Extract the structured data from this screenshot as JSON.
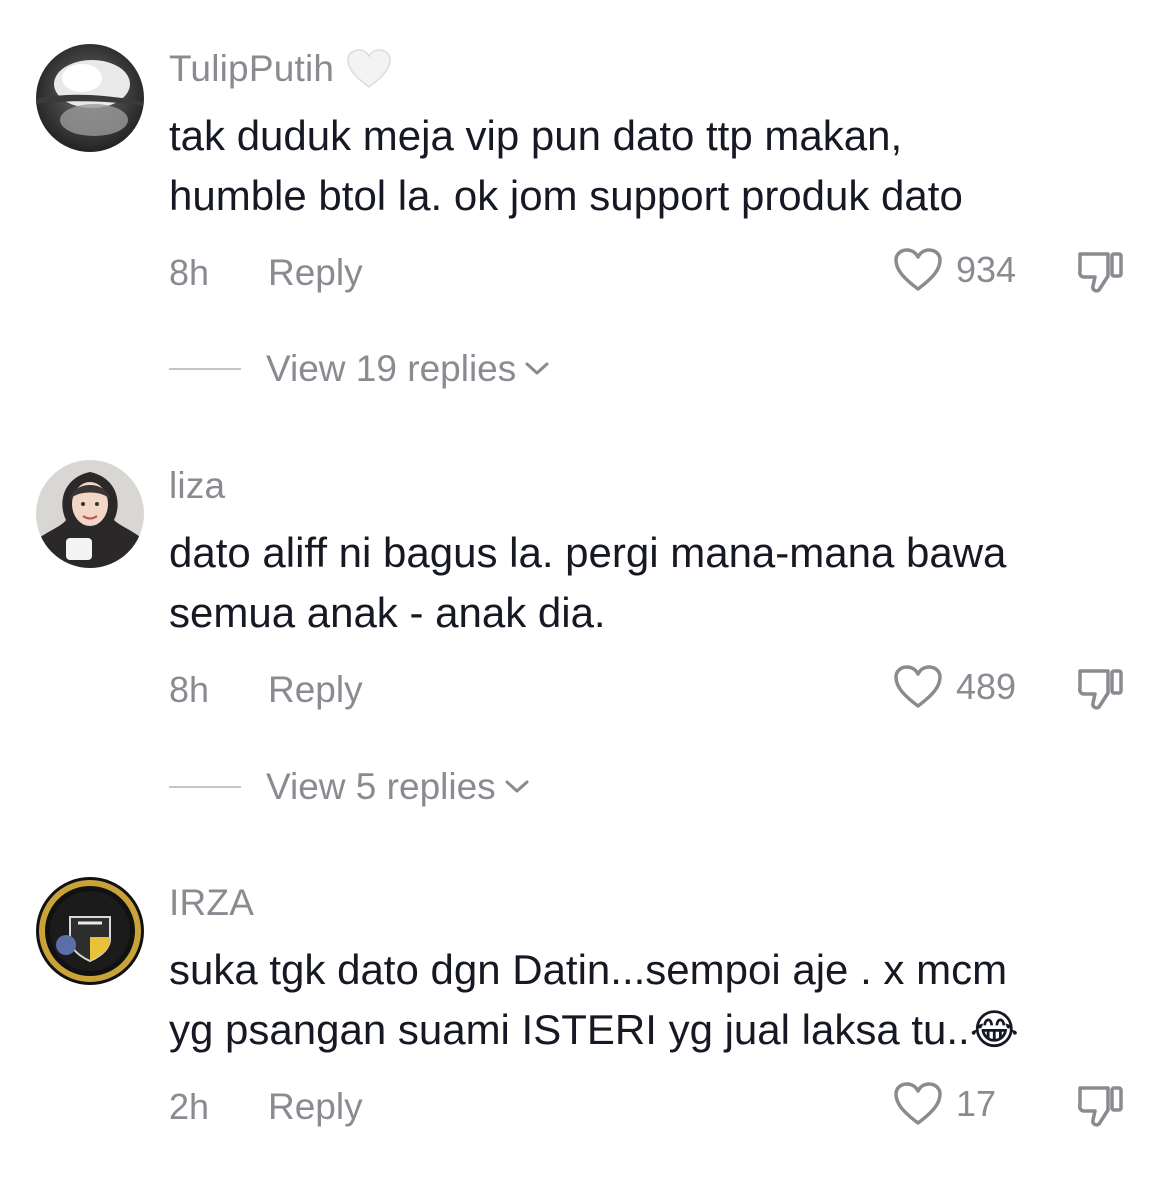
{
  "comments": [
    {
      "username": "TulipPutih",
      "text": "tak duduk meja vip pun dato ttp makan,\nhumble btol la. ok jom support produk dato",
      "time": "8h",
      "reply_label": "Reply",
      "likes": "934",
      "view_replies": "View 19 replies"
    },
    {
      "username": "liza",
      "text": "dato aliff ni bagus la. pergi mana-mana bawa\nsemua anak - anak dia.",
      "time": "8h",
      "reply_label": "Reply",
      "likes": "489",
      "view_replies": "View 5 replies"
    },
    {
      "username": "IRZA",
      "text": "suka tgk dato dgn Datin...sempoi aje . x mcm\nyg psangan suami ISTERI yg jual laksa tu..😂",
      "time": "2h",
      "reply_label": "Reply",
      "likes": "17"
    }
  ],
  "icons": {
    "username_badge": "white-heart-icon",
    "like": "heart-outline-icon",
    "dislike": "thumbs-down-icon",
    "expand": "chevron-down-icon"
  },
  "colors": {
    "text_primary": "#161823",
    "text_secondary": "#8a8b91",
    "divider": "#c4c5c9"
  }
}
